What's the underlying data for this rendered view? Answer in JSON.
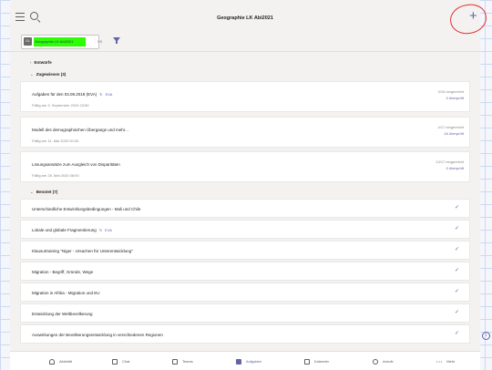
{
  "header": {
    "title": "Geographie LK Abi2021"
  },
  "filter": {
    "class_label": "Geographie LK Abi2021",
    "class_short": "VII"
  },
  "sections": {
    "drafts": "Entwürfe",
    "assigned": "Zugewiesen (3)",
    "graded": "Benotet (7)"
  },
  "assigned": [
    {
      "name": "Aufgaben für den 03.09.2019 (EVA)",
      "tag": "EVA",
      "due": "Fällig am 3. September 2019 23:59",
      "submitted": "3/16 eingereicht",
      "checked": "0 überprüft"
    },
    {
      "name": "Modell des demographischen Übergangs und mehr...",
      "tag": "",
      "due": "Fällig am 11. Mai 2020 00:30",
      "submitted": "4/17 eingereicht",
      "checked": "16 überprüft"
    },
    {
      "name": "Lösungsansätze zum Ausgleich von Disparitäten",
      "tag": "",
      "due": "Fällig am 28. Mai 2020 08:00",
      "submitted": "13/17 eingereicht",
      "checked": "0 überprüft"
    }
  ],
  "graded": [
    {
      "name": "Unterschiedliche Entwicklungsbedingungen - Mali und Chile",
      "tag": ""
    },
    {
      "name": "Lokale und globale Fragmentierung",
      "tag": "EVA"
    },
    {
      "name": "Klausurtraining \"Niger - Ursachen für Unterentwicklung\"",
      "tag": ""
    },
    {
      "name": "Migration - Begriff, Gründe, Wege",
      "tag": ""
    },
    {
      "name": "Migration in Afrika - Migration und EU",
      "tag": ""
    },
    {
      "name": "Entwicklung der Weltbevölkerung",
      "tag": ""
    },
    {
      "name": "Auswirkungen der Bevölkerungsentwicklung in verschiedenen Regionen",
      "tag": ""
    }
  ],
  "bottom_nav": [
    "Aktivität",
    "Chat",
    "Teams",
    "Aufgaben",
    "Kalender",
    "Anrufe",
    "Mehr"
  ],
  "icons": {
    "menu": "hamburger-icon",
    "search": "search-icon",
    "add": "plus-icon",
    "filter": "funnel-icon",
    "check": "checkmark-icon",
    "eva": "refresh-icon"
  },
  "colors": {
    "accent": "#6264a7",
    "highlight": "#2bff00",
    "annotation": "#e03030"
  }
}
